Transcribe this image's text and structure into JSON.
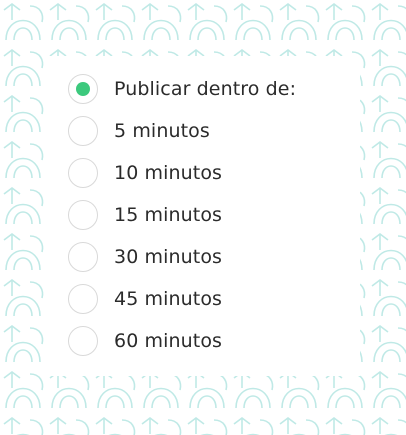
{
  "options": {
    "items": [
      {
        "label": "Publicar dentro de:",
        "selected": true
      },
      {
        "label": "5 minutos",
        "selected": false
      },
      {
        "label": "10 minutos",
        "selected": false
      },
      {
        "label": "15 minutos",
        "selected": false
      },
      {
        "label": "30 minutos",
        "selected": false
      },
      {
        "label": "45 minutos",
        "selected": false
      },
      {
        "label": "60 minutos",
        "selected": false
      }
    ]
  },
  "colors": {
    "selected_dot": "#3cc97d",
    "pattern_stroke": "#bfe9e6"
  }
}
